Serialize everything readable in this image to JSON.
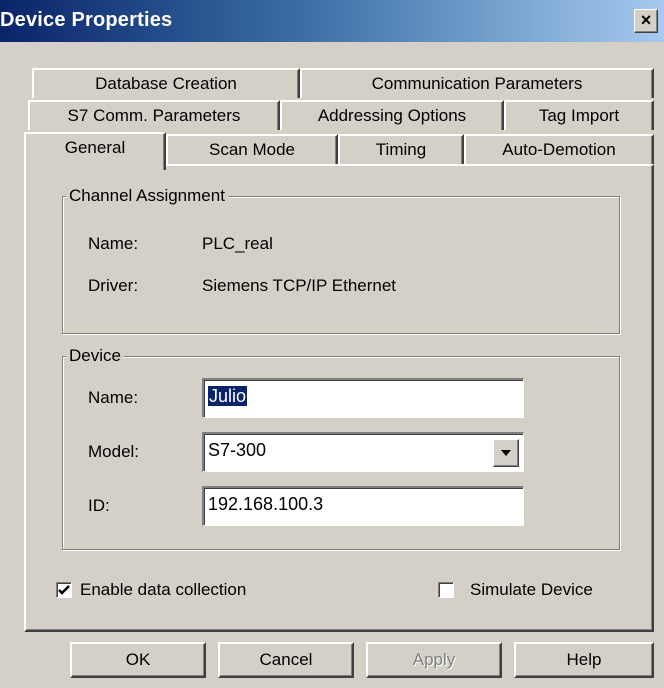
{
  "window": {
    "title": "Device Properties",
    "close_glyph": "×"
  },
  "tabs": {
    "row1": [
      "Database Creation",
      "Communication Parameters"
    ],
    "row2": [
      "S7 Comm. Parameters",
      "Addressing Options",
      "Tag Import"
    ],
    "row3": [
      "General",
      "Scan Mode",
      "Timing",
      "Auto-Demotion"
    ],
    "active": "General"
  },
  "channel": {
    "legend": "Channel Assignment",
    "name_label": "Name:",
    "name_value": "PLC_real",
    "driver_label": "Driver:",
    "driver_value": "Siemens TCP/IP Ethernet"
  },
  "device": {
    "legend": "Device",
    "name_label": "Name:",
    "name_value": "Julio",
    "model_label": "Model:",
    "model_value": "S7-300",
    "id_label": "ID:",
    "id_value": "192.168.100.3"
  },
  "options": {
    "enable_label": "Enable data collection",
    "enable_checked": true,
    "simulate_label": "Simulate Device",
    "simulate_checked": false
  },
  "buttons": {
    "ok": "OK",
    "cancel": "Cancel",
    "apply": "Apply",
    "help": "Help",
    "apply_enabled": false
  }
}
